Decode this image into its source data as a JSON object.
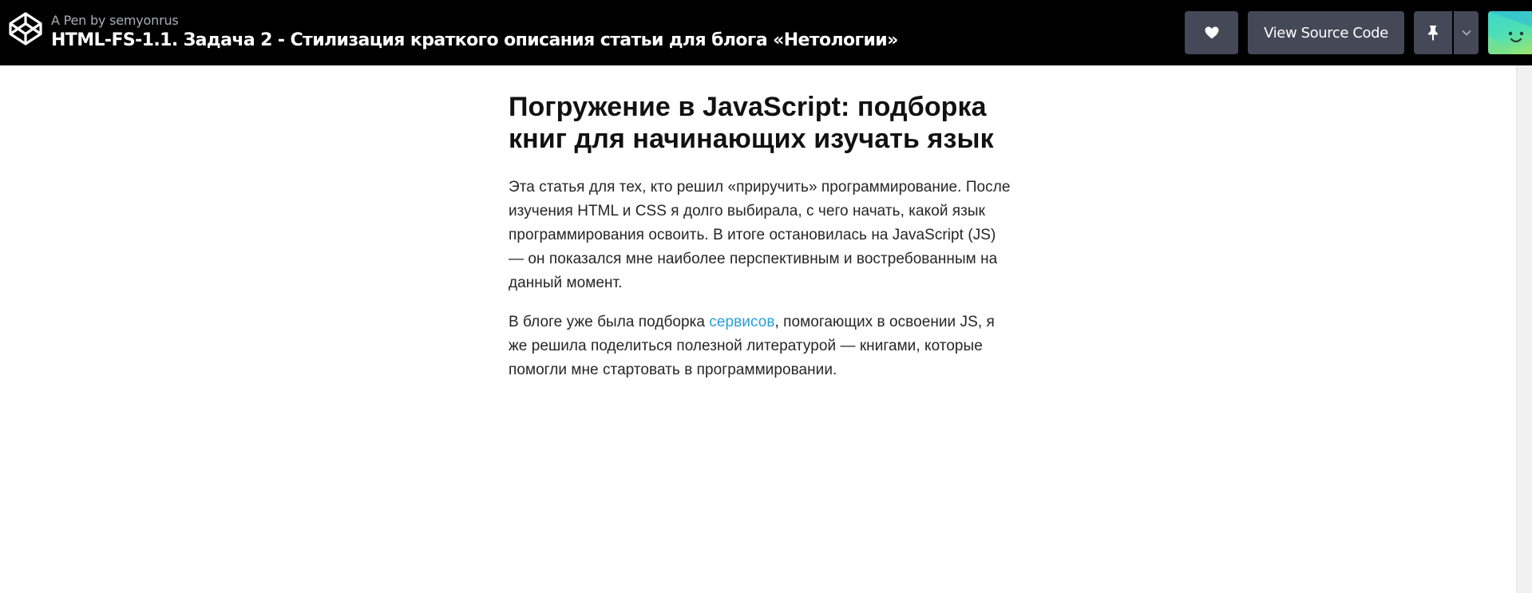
{
  "header": {
    "byline_prefix": "A Pen by",
    "author": "semyonrus",
    "title": "HTML-FS-1.1. Задача 2 - Стилизация краткого описания статьи для блога «Нетологии»",
    "view_source_label": "View Source Code"
  },
  "icons": {
    "logo": "codepen-logo",
    "heart": "heart-icon",
    "pin": "pin-icon",
    "caret": "chevron-down-icon",
    "avatar": "user-avatar"
  },
  "colors": {
    "header_bg": "#000000",
    "button_bg": "#444857",
    "link": "#2a9fd6",
    "text": "#262626"
  },
  "article": {
    "heading": "Погружение в JavaScript: подборка книг для начинающих изучать язык",
    "paragraph1": "Эта статья для тех, кто решил «приручить» программирование. После изучения HTML и CSS я долго выбирала, с чего начать, какой язык программирования освоить. В итоге остановилась на JavaScript (JS) — он показался мне наиболее перспективным и востребованным на данный момент.",
    "paragraph2_before": "В блоге уже была подборка ",
    "paragraph2_link": "сервисов",
    "paragraph2_after": ", помогающих в освоении JS, я же решила поделиться полезной литературой — книгами, которые помогли мне стартовать в программировании."
  }
}
